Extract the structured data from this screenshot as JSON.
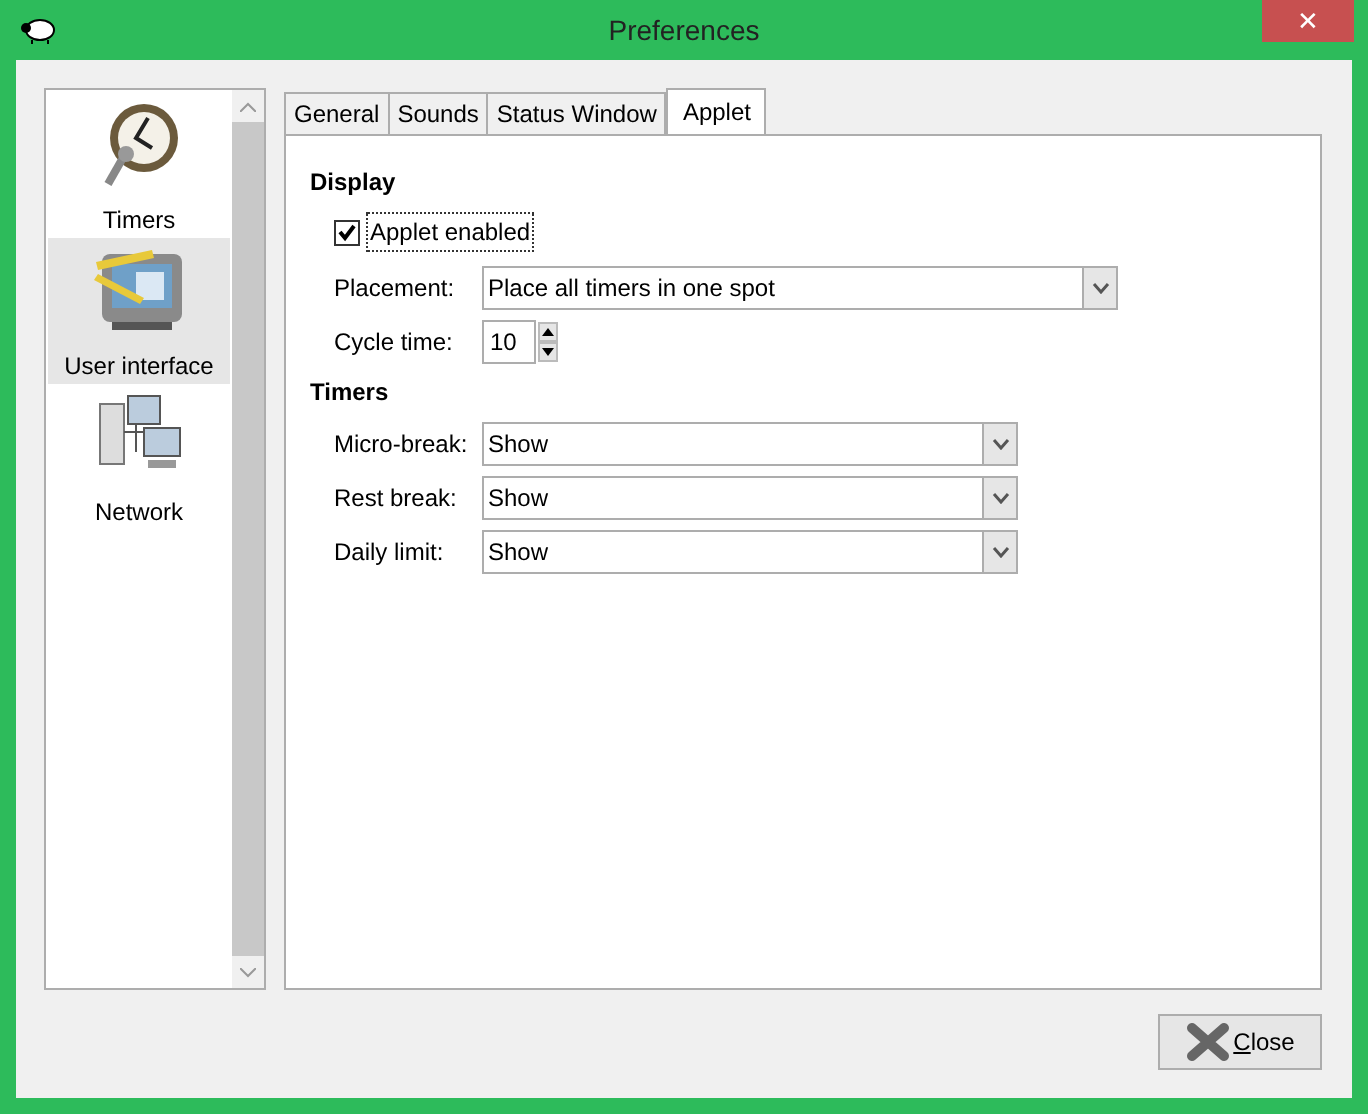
{
  "window": {
    "title": "Preferences",
    "close_glyph": "✕"
  },
  "sidebar": {
    "items": [
      {
        "label": "Timers",
        "kind": "clock",
        "selected": false
      },
      {
        "label": "User interface",
        "kind": "monitor",
        "selected": true
      },
      {
        "label": "Network",
        "kind": "network",
        "selected": false
      }
    ]
  },
  "tabs": [
    {
      "label": "General",
      "selected": false
    },
    {
      "label": "Sounds",
      "selected": false
    },
    {
      "label": "Status Window",
      "selected": false
    },
    {
      "label": "Applet",
      "selected": true
    }
  ],
  "sections": [
    {
      "title": "Display",
      "rows": [
        {
          "kind": "checkbox",
          "label": "Applet enabled",
          "checked": true,
          "focused": true
        },
        {
          "kind": "select",
          "label": "Placement:",
          "value": "Place all timers in one spot",
          "wide": true
        },
        {
          "kind": "spin",
          "label": "Cycle time:",
          "value": "10"
        }
      ]
    },
    {
      "title": "Timers",
      "rows": [
        {
          "kind": "select",
          "label": "Micro-break:",
          "value": "Show",
          "wide": false
        },
        {
          "kind": "select",
          "label": "Rest break:",
          "value": "Show",
          "wide": false
        },
        {
          "kind": "select",
          "label": "Daily limit:",
          "value": "Show",
          "wide": false
        }
      ]
    }
  ],
  "close_button": {
    "label": "Close"
  }
}
